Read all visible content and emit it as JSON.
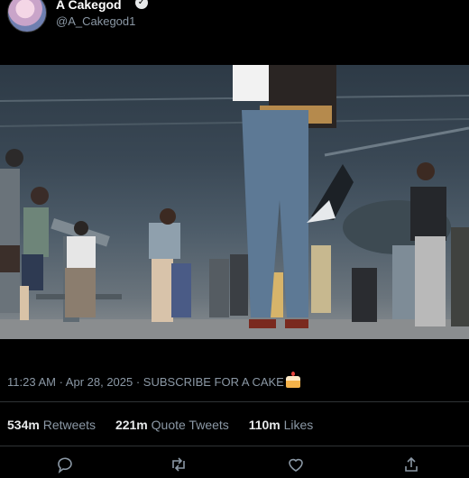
{
  "tweet": {
    "display_name": "A Cakegod",
    "handle": "@A_Cakegod1",
    "verified_icon": "verified-check-icon",
    "timestamp_text": "11:23 AM · Apr 28, 2025 · SUBSCRIBE FOR A CAKE",
    "media": {
      "type": "video-frame"
    }
  },
  "stats": {
    "retweets_count": "534m",
    "retweets_label": "Retweets",
    "quotes_count": "221m",
    "quotes_label": "Quote Tweets",
    "likes_count": "110m",
    "likes_label": "Likes"
  },
  "actions": [
    "reply-icon",
    "retweet-icon",
    "like-icon",
    "share-icon"
  ],
  "colors": {
    "background": "#000000",
    "text": "#e7e9ea",
    "muted": "#8b98a5",
    "divider": "#2f3336"
  }
}
